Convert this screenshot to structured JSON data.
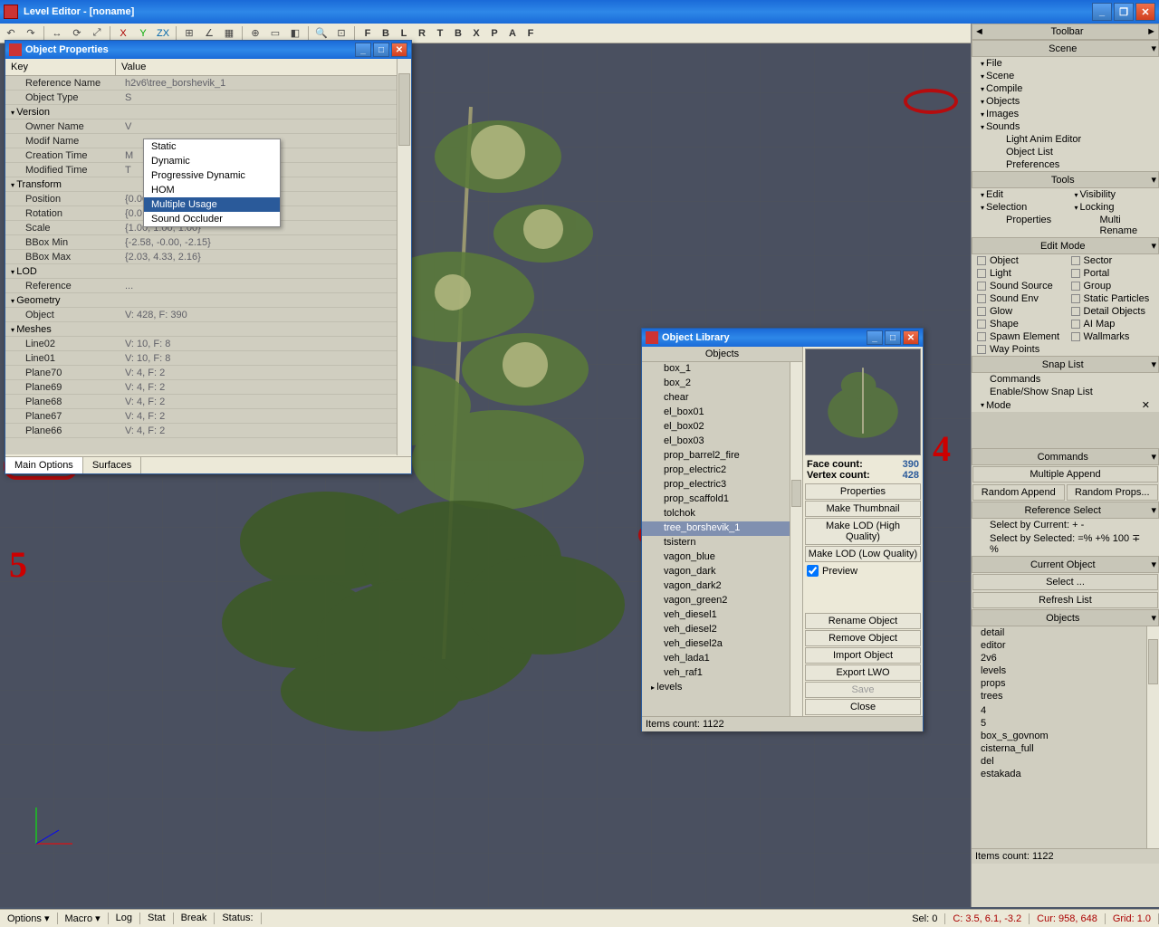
{
  "app": {
    "title": "Level Editor - [noname]"
  },
  "toolbar_letters": [
    "F",
    "B",
    "L",
    "R",
    "T",
    "B",
    "X",
    "P",
    "A",
    "F"
  ],
  "obj_props": {
    "title": "Object Properties",
    "key_header": "Key",
    "value_header": "Value",
    "rows": [
      {
        "k": "Reference Name",
        "v": "h2v6\\tree_borshevik_1",
        "ind": 1
      },
      {
        "k": "Object Type",
        "v": "S",
        "ind": 1
      },
      {
        "k": "Version",
        "v": "",
        "ind": 0,
        "group": true
      },
      {
        "k": "Owner Name",
        "v": "V",
        "ind": 1
      },
      {
        "k": "Modif Name",
        "v": "",
        "ind": 1
      },
      {
        "k": "Creation Time",
        "v": "M",
        "ind": 1
      },
      {
        "k": "Modified Time",
        "v": "T",
        "ind": 1
      },
      {
        "k": "Transform",
        "v": "",
        "ind": 0,
        "group": true
      },
      {
        "k": "Position",
        "v": "{0.00, 0.00, 0.00}",
        "ind": 1
      },
      {
        "k": "Rotation",
        "v": "{0.0, 0.0, 0.0}",
        "ind": 1
      },
      {
        "k": "Scale",
        "v": "{1.00, 1.00, 1.00}",
        "ind": 1
      },
      {
        "k": "BBox Min",
        "v": "{-2.58, -0.00, -2.15}",
        "ind": 1
      },
      {
        "k": "BBox Max",
        "v": "{2.03, 4.33, 2.16}",
        "ind": 1
      },
      {
        "k": "LOD",
        "v": "",
        "ind": 0,
        "group": true
      },
      {
        "k": "Reference",
        "v": "...",
        "ind": 1
      },
      {
        "k": "Geometry",
        "v": "",
        "ind": 0,
        "group": true
      },
      {
        "k": "Object",
        "v": "V: 428, F: 390",
        "ind": 1
      },
      {
        "k": "Meshes",
        "v": "",
        "ind": 0,
        "group": true
      },
      {
        "k": "Line02",
        "v": "V: 10, F: 8",
        "ind": 1
      },
      {
        "k": "Line01",
        "v": "V: 10, F: 8",
        "ind": 1
      },
      {
        "k": "Plane70",
        "v": "V: 4, F: 2",
        "ind": 1
      },
      {
        "k": "Plane69",
        "v": "V: 4, F: 2",
        "ind": 1
      },
      {
        "k": "Plane68",
        "v": "V: 4, F: 2",
        "ind": 1
      },
      {
        "k": "Plane67",
        "v": "V: 4, F: 2",
        "ind": 1
      },
      {
        "k": "Plane66",
        "v": "V: 4, F: 2",
        "ind": 1
      }
    ],
    "tabs": [
      "Main Options",
      "Surfaces"
    ],
    "dropdown": [
      "Static",
      "Dynamic",
      "Progressive Dynamic",
      "HOM",
      "Multiple Usage",
      "Sound Occluder"
    ]
  },
  "obj_lib": {
    "title": "Object Library",
    "objects_header": "Objects",
    "items": [
      "box_1",
      "box_2",
      "chear",
      "el_box01",
      "el_box02",
      "el_box03",
      "prop_barrel2_fire",
      "prop_electric2",
      "prop_electric3",
      "prop_scaffold1",
      "tolchok",
      "tree_borshevik_1",
      "tsistern",
      "vagon_blue",
      "vagon_dark",
      "vagon_dark2",
      "vagon_green2",
      "veh_diesel1",
      "veh_diesel2",
      "veh_diesel2a",
      "veh_lada1",
      "veh_raf1"
    ],
    "expand_items": [
      "levels"
    ],
    "selected": "tree_borshevik_1",
    "items_count": "Items count: 1122",
    "face_label": "Face count:",
    "face_val": "390",
    "vertex_label": "Vertex count:",
    "vertex_val": "428",
    "buttons": [
      "Properties",
      "Make Thumbnail",
      "Make LOD (High Quality)",
      "Make LOD (Low Quality)"
    ],
    "preview_label": "Preview",
    "buttons2": [
      "Rename Object",
      "Remove Object",
      "Import Object",
      "Export LWO",
      "Save",
      "Close"
    ]
  },
  "right": {
    "toolbar": "Toolbar",
    "scene": "Scene",
    "scene_items": [
      "File",
      "Scene",
      "Compile",
      "Objects",
      "Images",
      "Sounds",
      "Light Anim Editor",
      "Object List",
      "Preferences"
    ],
    "tools": "Tools",
    "tool_cols": [
      [
        "Edit",
        "Selection",
        "Properties"
      ],
      [
        "Visibility",
        "Locking",
        "Multi Rename"
      ]
    ],
    "edit_mode": "Edit Mode",
    "edit_grid": [
      [
        "Object",
        "Sector"
      ],
      [
        "Light",
        "Portal"
      ],
      [
        "Sound Source",
        "Group"
      ],
      [
        "Sound Env",
        "Static Particles"
      ],
      [
        "Glow",
        "Detail Objects"
      ],
      [
        "Shape",
        "AI Map"
      ],
      [
        "Spawn Element",
        "Wallmarks"
      ],
      [
        "Way Points",
        ""
      ]
    ],
    "snap_list": "Snap List",
    "snap_items": [
      "Commands",
      "Enable/Show Snap List"
    ],
    "mode": "Mode",
    "commands": "Commands",
    "cmd_row1": [
      "Multiple Append"
    ],
    "cmd_row2": [
      "Random Append",
      "Random Props..."
    ],
    "ref_select": "Reference Select",
    "ref_rows": [
      "Select by Current:    +    -",
      "Select by Selected:   =%   +%   100   ∓ %"
    ],
    "cur_obj": "Current Object",
    "cur_btns": [
      "Select ...",
      "Refresh List"
    ],
    "objects": "Objects",
    "obj_list": [
      "detail",
      "editor",
      "2v6",
      "levels",
      "props",
      "trees",
      "",
      "4",
      "5",
      "box_s_govnom",
      "cisterna_full",
      "del",
      "estakada"
    ],
    "obj_count": "Items count: 1122"
  },
  "status": {
    "left": [
      "Options ▾",
      "Macro ▾",
      "Log",
      "Stat",
      "Break",
      "Status:"
    ],
    "right": [
      "Sel: 0",
      "C: 3.5, 6.1, -3.2",
      "Cur: 958, 648",
      "Grid: 1.0"
    ]
  }
}
